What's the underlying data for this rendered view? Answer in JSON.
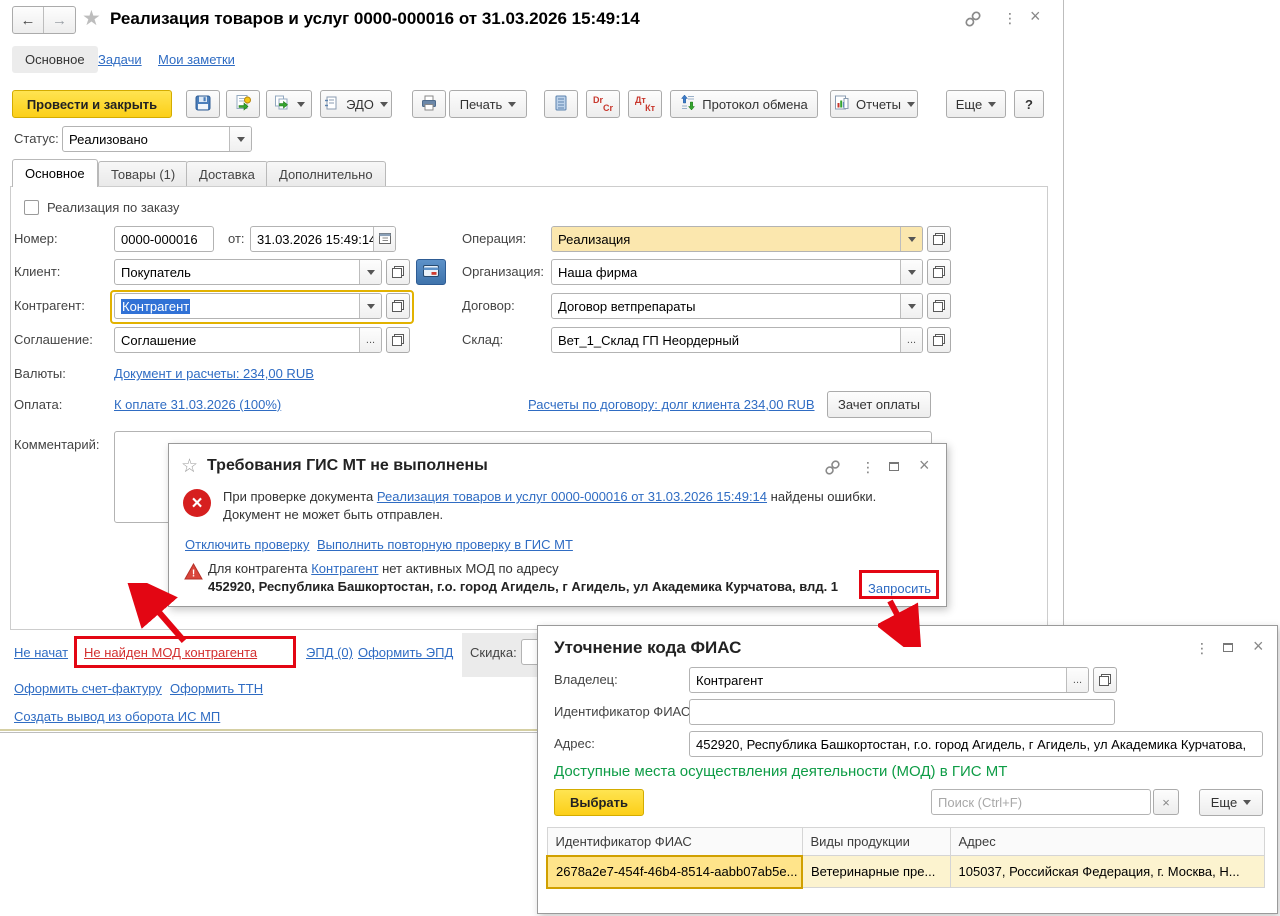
{
  "header": {
    "title": "Реализация товаров и услуг 0000-000016 от 31.03.2026 15:49:14",
    "nav_tabs": {
      "main": "Основное",
      "tasks": "Задачи",
      "notes": "Мои заметки"
    }
  },
  "toolbar": {
    "post_and_close": "Провести и закрыть",
    "edo": "ЭДО",
    "print": "Печать",
    "dr_cr": {
      "top": "Dr",
      "bottom": "Cr"
    },
    "dt_kt": {
      "top": "Дт",
      "bottom": "Кт"
    },
    "protocol": "Протокол обмена",
    "reports": "Отчеты",
    "more": "Еще",
    "help": "?"
  },
  "status": {
    "label": "Статус:",
    "value": "Реализовано"
  },
  "doc_tabs": {
    "main": "Основное",
    "goods": "Товары (1)",
    "delivery": "Доставка",
    "extra": "Дополнительно"
  },
  "form": {
    "order_checkbox_label": "Реализация по заказу",
    "number_label": "Номер:",
    "number_value": "0000-000016",
    "date_label": "от:",
    "date_value": "31.03.2026 15:49:14",
    "operation_label": "Операция:",
    "operation_value": "Реализация",
    "client_label": "Клиент:",
    "client_value": "Покупатель",
    "organization_label": "Организация:",
    "organization_value": "Наша фирма",
    "counterparty_label": "Контрагент:",
    "counterparty_value": "Контрагент",
    "contract_label": "Договор:",
    "contract_value": "Договор ветпрепараты",
    "agreement_label": "Соглашение:",
    "agreement_value": "Соглашение",
    "warehouse_label": "Склад:",
    "warehouse_value": "Вет_1_Склад ГП Неордерный",
    "currencies_label": "Валюты:",
    "currencies_link": "Документ и расчеты: 234,00 RUB",
    "payment_label": "Оплата:",
    "payment_link": "К оплате 31.03.2026 (100%)",
    "settlements_link": "Расчеты по договору: долг клиента 234,00 RUB",
    "offset_button": "Зачет оплаты",
    "comment_label": "Комментарий:"
  },
  "footer": {
    "not_started_link": "Не начат",
    "mod_not_found_link": "Не найден МОД контрагента",
    "epd_link": "ЭПД (0)",
    "epd_create_link": "Оформить ЭПД",
    "discount_label": "Скидка:",
    "invoice_link": "Оформить счет-фактуру",
    "ttn_link": "Оформить ТТН",
    "withdrawal_link": "Создать вывод из оборота ИС МП"
  },
  "gis_dialog": {
    "title": "Требования ГИС МТ не выполнены",
    "error_text_prefix": "При проверке документа",
    "error_doc_link": "Реализация товаров и услуг 0000-000016 от 31.03.2026 15:49:14",
    "error_text_suffix": "найдены ошибки.",
    "error_text_line2": "Документ не может быть отправлен.",
    "disable_check_link": "Отключить проверку",
    "recheck_link": "Выполнить повторную проверку в ГИС МТ",
    "warning_prefix": "Для контрагента",
    "warning_counterparty_link": "Контрагент",
    "warning_suffix": "нет активных МОД по адресу",
    "warning_address": "452920, Республика Башкортостан, г.о. город Агидель, г Агидель, ул Академика Курчатова, влд. 1",
    "request_link": "Запросить"
  },
  "fias_dialog": {
    "title": "Уточнение кода ФИАС",
    "owner_label": "Владелец:",
    "owner_value": "Контрагент",
    "fias_id_label": "Идентификатор ФИАС:",
    "fias_id_value": "",
    "address_label": "Адрес:",
    "address_value": "452920, Республика Башкортостан, г.о. город Агидель, г Агидель, ул Академика Курчатова,",
    "mod_heading": "Доступные места осуществления деятельности (МОД) в ГИС МТ",
    "select_button": "Выбрать",
    "search_placeholder": "Поиск (Ctrl+F)",
    "more_button": "Еще",
    "table": {
      "headers": [
        "Идентификатор ФИАС",
        "Виды продукции",
        "Адрес"
      ],
      "rows": [
        [
          "2678a2e7-454f-46b4-8514-aabb07ab5e...",
          "Ветеринарные пре...",
          "105037, Российская Федерация, г. Москва, Н..."
        ]
      ]
    }
  },
  "icons": {
    "back": "←",
    "forward": "→",
    "star": "★",
    "star_outline": "☆",
    "kebab": "⋮",
    "close": "×",
    "ellipsis": "...",
    "error_x": "×"
  },
  "colors": {
    "accent_yellow": "#fccf18",
    "link_blue": "#2f6cc3",
    "error_red": "#d61f1f",
    "annotation_red": "#e30613",
    "green_heading": "#0e9c46",
    "field_highlight": "#fbe7ae",
    "selection_blue": "#3172d6",
    "row_selected": "#ffe48a"
  }
}
